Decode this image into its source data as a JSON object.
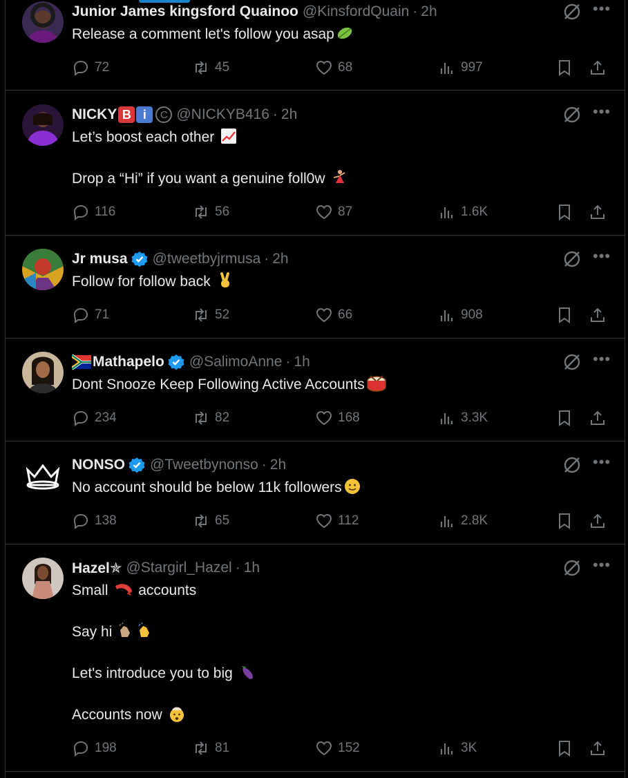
{
  "colors": {
    "background": "#000000",
    "text": "#e7e9ea",
    "muted": "#71767b",
    "border": "#2f3336",
    "verified": "#1d9bf0"
  },
  "tweets": [
    {
      "name": "Junior James kingsford Quainoo",
      "handle": "@KinsfordQuain",
      "time": "2h",
      "verified": false,
      "lines": [
        "Release a comment let's follow you asap"
      ],
      "emoji": [
        "leaf"
      ],
      "replies": "72",
      "reposts": "45",
      "likes": "68",
      "views": "997"
    },
    {
      "name": "NICKY",
      "name_badges": [
        "B",
        "i",
        "C"
      ],
      "handle": "@NICKYB416",
      "time": "2h",
      "verified": false,
      "lines": [
        "Let’s boost each other",
        "",
        "Drop a “Hi” if you want a genuine foll0w"
      ],
      "emoji": [
        "chart-increasing",
        "dancer"
      ],
      "replies": "116",
      "reposts": "56",
      "likes": "87",
      "views": "1.6K"
    },
    {
      "name": "Jr musa",
      "handle": "@tweetbyjrmusa",
      "time": "2h",
      "verified": true,
      "lines": [
        "Follow for follow back"
      ],
      "emoji": [
        "victory-hand"
      ],
      "replies": "71",
      "reposts": "52",
      "likes": "66",
      "views": "908"
    },
    {
      "name": "Mathapelo",
      "name_prefix_emoji": "south-africa-flag",
      "handle": "@SalimoAnne",
      "time": "1h",
      "verified": true,
      "lines": [
        "Dont Snooze Keep Following Active Accounts"
      ],
      "emoji": [
        "drum"
      ],
      "replies": "234",
      "reposts": "82",
      "likes": "168",
      "views": "3.3K"
    },
    {
      "name": "NONSO",
      "handle": "@Tweetbynonso",
      "time": "2h",
      "verified": true,
      "lines": [
        "No account should be below 11k followers"
      ],
      "emoji": [
        "smiling-face"
      ],
      "replies": "138",
      "reposts": "65",
      "likes": "112",
      "views": "2.8K"
    },
    {
      "name": "Hazel✯",
      "handle": "@Stargirl_Hazel",
      "time": "1h",
      "verified": false,
      "lines": [
        "Small",
        "",
        "Say hi",
        "",
        "Let's introduce you to big",
        "",
        "Accounts now"
      ],
      "emoji": [
        "shrimp",
        "clapping-hands",
        "eggplant",
        "exploding-head"
      ],
      "line1_suffix": "accounts",
      "replies": "198",
      "reposts": "81",
      "likes": "152",
      "views": "3K"
    }
  ]
}
